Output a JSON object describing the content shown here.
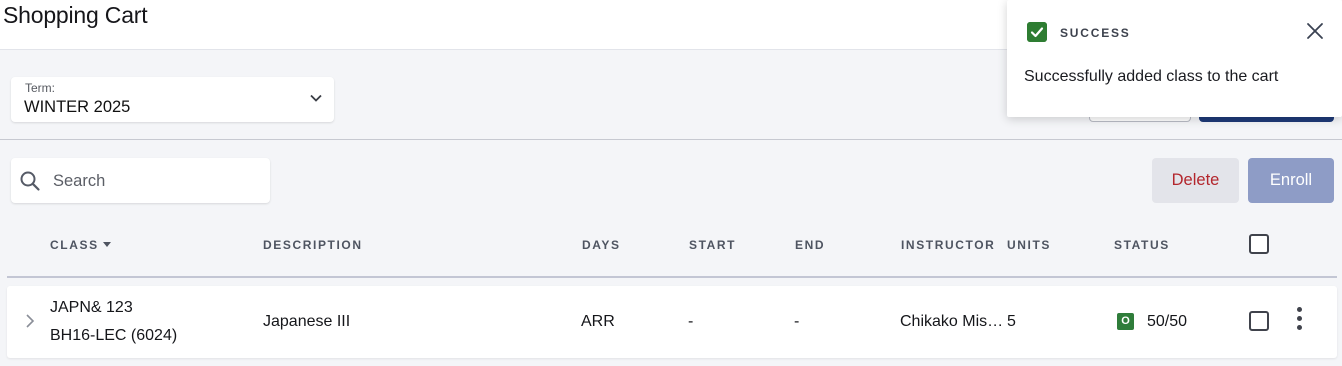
{
  "header": {
    "title": "Shopping Cart"
  },
  "term": {
    "label": "Term:",
    "value": "WINTER 2025",
    "icon": "chevron-down-icon"
  },
  "search": {
    "placeholder": "Search",
    "value": "",
    "icon": "search-icon"
  },
  "actions": {
    "delete_label": "Delete",
    "enroll_label": "Enroll"
  },
  "table": {
    "columns": [
      "CLASS",
      "DESCRIPTION",
      "DAYS",
      "START",
      "END",
      "INSTRUCTOR",
      "UNITS",
      "STATUS"
    ],
    "sorted_column": "CLASS",
    "rows": [
      {
        "class_code": "JAPN& 123",
        "section": "BH16-LEC (6024)",
        "description": "Japanese III",
        "days": "ARR",
        "start": "-",
        "end": "-",
        "instructor": "Chikako Mis…",
        "units": "5",
        "status_badge": "O",
        "seats": "50/50"
      }
    ]
  },
  "toast": {
    "title": "SUCCESS",
    "message": "Successfully added class to the cart",
    "icon": "check-icon",
    "close_icon": "close-icon"
  },
  "colors": {
    "accent": "#1e3a78",
    "enroll_button": "#8e9cc6",
    "delete_text": "#b3262d",
    "success": "#2e7d32"
  }
}
